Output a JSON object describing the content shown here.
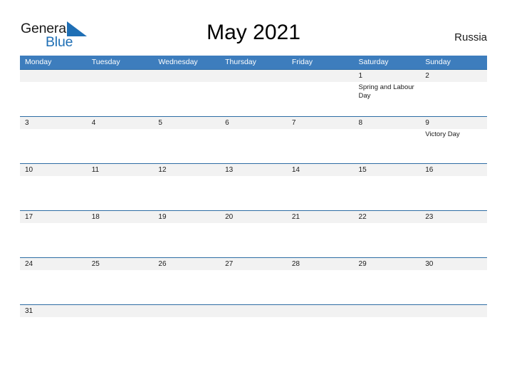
{
  "brand": {
    "name_part1": "General",
    "name_part2": "Blue",
    "flag_icon": "blue-triangle-flag-icon",
    "color_dark": "#1b1b1b",
    "color_blue": "#1f6fb5"
  },
  "header": {
    "title": "May 2021",
    "country": "Russia"
  },
  "theme": {
    "header_blue": "#3d7dbd",
    "rule_blue": "#2e6da4",
    "number_strip_gray": "#f2f2f2",
    "text_dark": "#1b1b1b",
    "text_white": "#ffffff"
  },
  "calendar": {
    "month": "May",
    "year": "2021",
    "weekday_headers": [
      "Monday",
      "Tuesday",
      "Wednesday",
      "Thursday",
      "Friday",
      "Saturday",
      "Sunday"
    ],
    "weeks": [
      {
        "days": [
          {
            "number": "",
            "events": []
          },
          {
            "number": "",
            "events": []
          },
          {
            "number": "",
            "events": []
          },
          {
            "number": "",
            "events": []
          },
          {
            "number": "",
            "events": []
          },
          {
            "number": "1",
            "events": [
              "Spring and Labour Day"
            ]
          },
          {
            "number": "2",
            "events": []
          }
        ]
      },
      {
        "days": [
          {
            "number": "3",
            "events": []
          },
          {
            "number": "4",
            "events": []
          },
          {
            "number": "5",
            "events": []
          },
          {
            "number": "6",
            "events": []
          },
          {
            "number": "7",
            "events": []
          },
          {
            "number": "8",
            "events": []
          },
          {
            "number": "9",
            "events": [
              "Victory Day"
            ]
          }
        ]
      },
      {
        "days": [
          {
            "number": "10",
            "events": []
          },
          {
            "number": "11",
            "events": []
          },
          {
            "number": "12",
            "events": []
          },
          {
            "number": "13",
            "events": []
          },
          {
            "number": "14",
            "events": []
          },
          {
            "number": "15",
            "events": []
          },
          {
            "number": "16",
            "events": []
          }
        ]
      },
      {
        "days": [
          {
            "number": "17",
            "events": []
          },
          {
            "number": "18",
            "events": []
          },
          {
            "number": "19",
            "events": []
          },
          {
            "number": "20",
            "events": []
          },
          {
            "number": "21",
            "events": []
          },
          {
            "number": "22",
            "events": []
          },
          {
            "number": "23",
            "events": []
          }
        ]
      },
      {
        "days": [
          {
            "number": "24",
            "events": []
          },
          {
            "number": "25",
            "events": []
          },
          {
            "number": "26",
            "events": []
          },
          {
            "number": "27",
            "events": []
          },
          {
            "number": "28",
            "events": []
          },
          {
            "number": "29",
            "events": []
          },
          {
            "number": "30",
            "events": []
          }
        ]
      },
      {
        "last": true,
        "days": [
          {
            "number": "31",
            "events": []
          },
          {
            "number": "",
            "events": []
          },
          {
            "number": "",
            "events": []
          },
          {
            "number": "",
            "events": []
          },
          {
            "number": "",
            "events": []
          },
          {
            "number": "",
            "events": []
          },
          {
            "number": "",
            "events": []
          }
        ]
      }
    ]
  }
}
